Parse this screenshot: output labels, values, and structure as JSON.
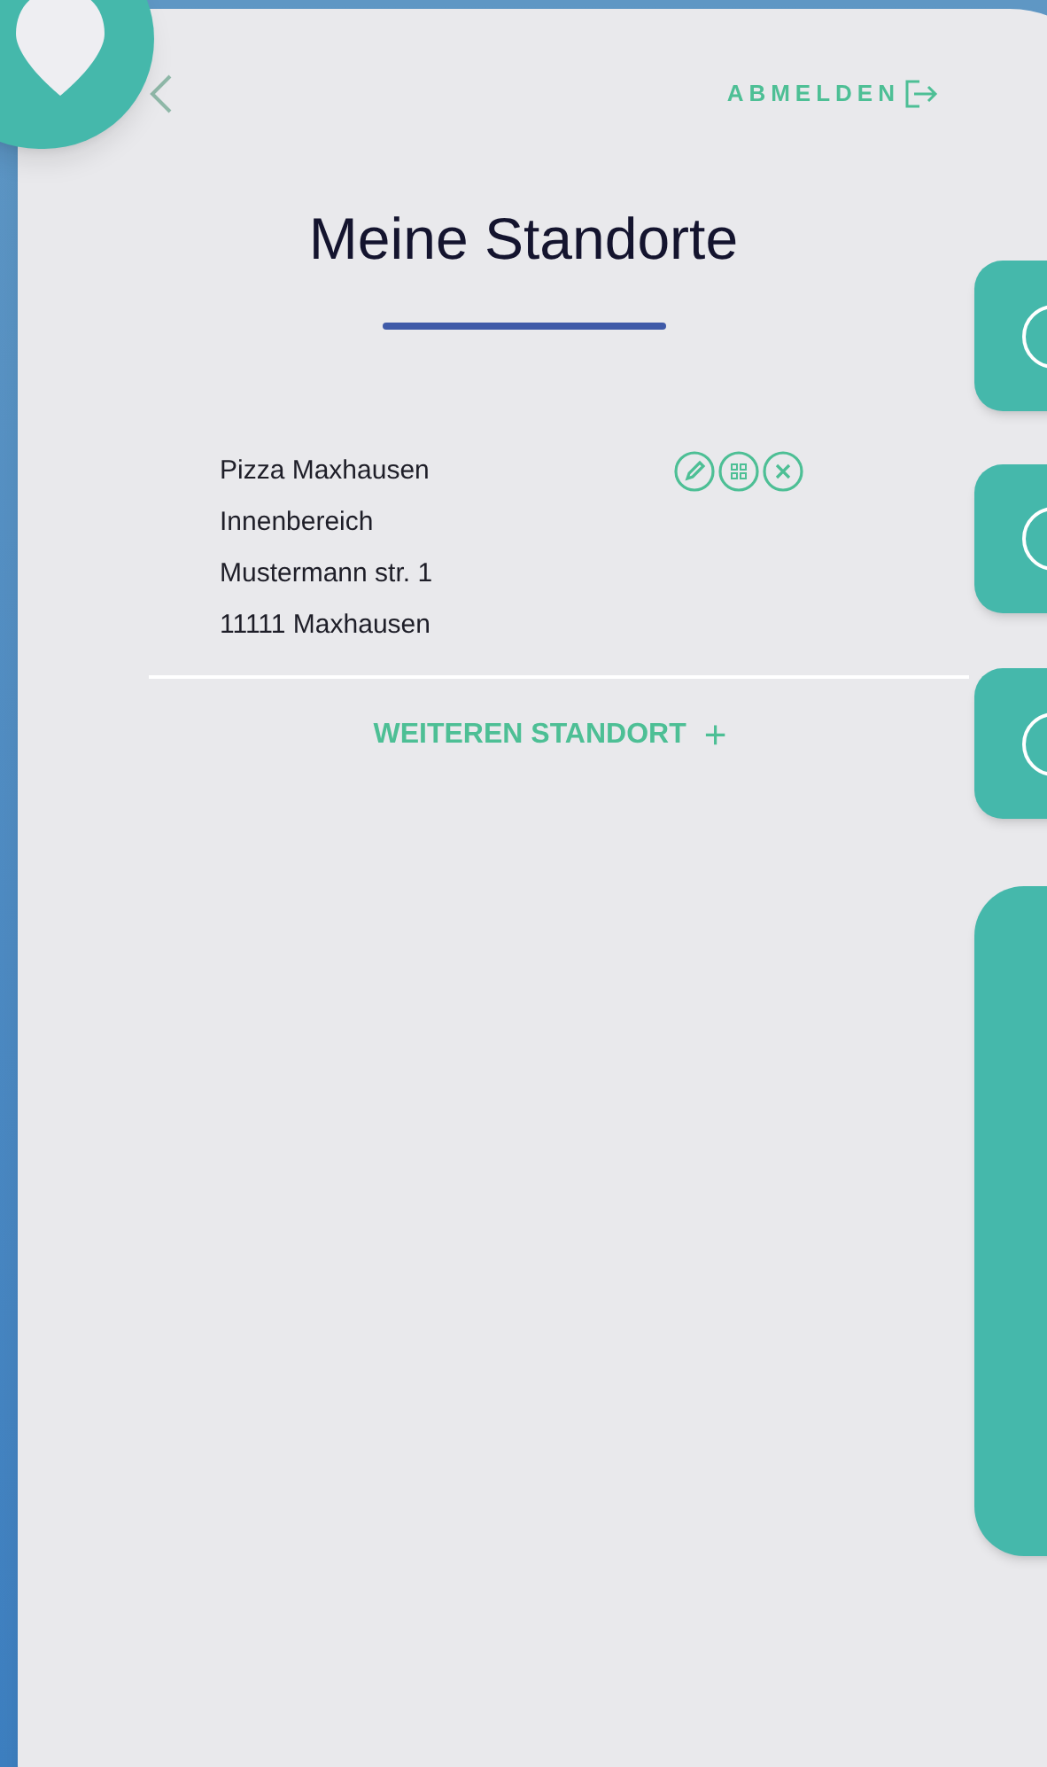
{
  "header": {
    "logout": "ABMELDEN"
  },
  "title": "Meine Standorte",
  "locations": [
    {
      "lines": [
        "Pizza Maxhausen",
        "Innenbereich",
        "Mustermann str. 1",
        "11111 Maxhausen"
      ]
    }
  ],
  "add_button": "WEITEREN STANDORT",
  "add_icon": "+"
}
